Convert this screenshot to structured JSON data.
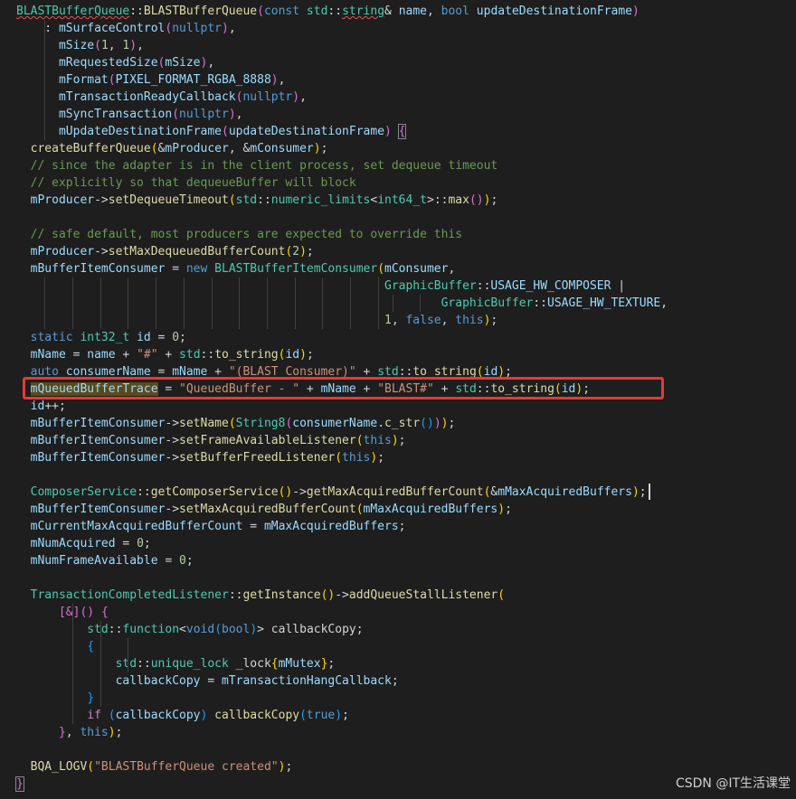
{
  "colors": {
    "background": "#1e1e1e",
    "plain": "#d4d4d4",
    "keyword": "#569cd6",
    "control": "#c586c0",
    "type": "#4ec9b0",
    "function": "#dcdcaa",
    "variable": "#9cdcfe",
    "string": "#ce9178",
    "number": "#b5cea8",
    "comment": "#6a9955",
    "bracket1": "#ffd700",
    "bracket2": "#da70d6",
    "bracket3": "#179fff",
    "highlight_box": "#e53935"
  },
  "watermark": "CSDN @IT生活课堂",
  "code_lines": [
    [
      [
        "BLASTBufferQueue",
        "t",
        "sq"
      ],
      [
        "::",
        "p"
      ],
      [
        "BLASTBufferQueue",
        "f"
      ],
      [
        "(",
        "b2"
      ],
      [
        "const",
        "k"
      ],
      [
        " ",
        "p"
      ],
      [
        "std",
        "t"
      ],
      [
        "::",
        "p"
      ],
      [
        "string",
        "t",
        "sq"
      ],
      [
        "& ",
        "p"
      ],
      [
        "name",
        "v"
      ],
      [
        ", ",
        "p"
      ],
      [
        "bool",
        "k"
      ],
      [
        " ",
        "p"
      ],
      [
        "updateDestinationFrame",
        "v"
      ],
      [
        ")",
        "b2"
      ]
    ],
    [
      [
        "    : ",
        "p"
      ],
      [
        "mSurfaceControl",
        "v"
      ],
      [
        "(",
        "b2"
      ],
      [
        "nullptr",
        "k"
      ],
      [
        ")",
        "b2"
      ],
      [
        ",",
        "p"
      ]
    ],
    [
      [
        "      ",
        "p"
      ],
      [
        "mSize",
        "v"
      ],
      [
        "(",
        "b2"
      ],
      [
        "1",
        "n"
      ],
      [
        ", ",
        "p"
      ],
      [
        "1",
        "n"
      ],
      [
        ")",
        "b2"
      ],
      [
        ",",
        "p"
      ]
    ],
    [
      [
        "      ",
        "p"
      ],
      [
        "mRequestedSize",
        "v"
      ],
      [
        "(",
        "b2"
      ],
      [
        "mSize",
        "v"
      ],
      [
        ")",
        "b2"
      ],
      [
        ",",
        "p"
      ]
    ],
    [
      [
        "      ",
        "p"
      ],
      [
        "mFormat",
        "v"
      ],
      [
        "(",
        "b2"
      ],
      [
        "PIXEL_FORMAT_RGBA_8888",
        "v"
      ],
      [
        ")",
        "b2"
      ],
      [
        ",",
        "p"
      ]
    ],
    [
      [
        "      ",
        "p"
      ],
      [
        "mTransactionReadyCallback",
        "v"
      ],
      [
        "(",
        "b2"
      ],
      [
        "nullptr",
        "k"
      ],
      [
        ")",
        "b2"
      ],
      [
        ",",
        "p"
      ]
    ],
    [
      [
        "      ",
        "p"
      ],
      [
        "mSyncTransaction",
        "v"
      ],
      [
        "(",
        "b2"
      ],
      [
        "nullptr",
        "k"
      ],
      [
        ")",
        "b2"
      ],
      [
        ",",
        "p"
      ]
    ],
    [
      [
        "      ",
        "p"
      ],
      [
        "mUpdateDestinationFrame",
        "v"
      ],
      [
        "(",
        "b2"
      ],
      [
        "updateDestinationFrame",
        "v"
      ],
      [
        ")",
        "b2"
      ],
      [
        " ",
        "p"
      ],
      [
        "{",
        "b2",
        "bm"
      ]
    ],
    [
      [
        "  ",
        "p"
      ],
      [
        "createBufferQueue",
        "f"
      ],
      [
        "(",
        "b1"
      ],
      [
        "&",
        "p"
      ],
      [
        "mProducer",
        "v"
      ],
      [
        ", &",
        "p"
      ],
      [
        "mConsumer",
        "v"
      ],
      [
        ")",
        "b1"
      ],
      [
        ";",
        "p"
      ]
    ],
    [
      [
        "  ",
        "p"
      ],
      [
        "// since the adapter is in the client process, set dequeue timeout",
        "c"
      ]
    ],
    [
      [
        "  ",
        "p"
      ],
      [
        "// explicitly so that dequeueBuffer will block",
        "c"
      ]
    ],
    [
      [
        "  ",
        "p"
      ],
      [
        "mProducer",
        "v"
      ],
      [
        "->",
        "p"
      ],
      [
        "setDequeueTimeout",
        "f"
      ],
      [
        "(",
        "b1"
      ],
      [
        "std",
        "t"
      ],
      [
        "::",
        "p"
      ],
      [
        "numeric_limits",
        "t"
      ],
      [
        "<",
        "p"
      ],
      [
        "int64_t",
        "t"
      ],
      [
        ">::",
        "p"
      ],
      [
        "max",
        "f"
      ],
      [
        "()",
        "b2"
      ],
      [
        ")",
        "b1"
      ],
      [
        ";",
        "p"
      ]
    ],
    [],
    [
      [
        "  ",
        "p"
      ],
      [
        "// safe default, most producers are expected to override this",
        "c"
      ]
    ],
    [
      [
        "  ",
        "p"
      ],
      [
        "mProducer",
        "v"
      ],
      [
        "->",
        "p"
      ],
      [
        "setMaxDequeuedBufferCount",
        "f"
      ],
      [
        "(",
        "b1"
      ],
      [
        "2",
        "n"
      ],
      [
        ")",
        "b1"
      ],
      [
        ";",
        "p"
      ]
    ],
    [
      [
        "  ",
        "p"
      ],
      [
        "mBufferItemConsumer",
        "v"
      ],
      [
        " = ",
        "p"
      ],
      [
        "new",
        "k"
      ],
      [
        " ",
        "p"
      ],
      [
        "BLASTBufferItemConsumer",
        "t"
      ],
      [
        "(",
        "b1"
      ],
      [
        "mConsumer",
        "v"
      ],
      [
        ",",
        "p"
      ]
    ],
    [
      [
        "                                                    ",
        "p"
      ],
      [
        "GraphicBuffer",
        "t"
      ],
      [
        "::",
        "p"
      ],
      [
        "USAGE_HW_COMPOSER",
        "v"
      ],
      [
        " |",
        "p"
      ]
    ],
    [
      [
        "                                                            ",
        "p"
      ],
      [
        "GraphicBuffer",
        "t"
      ],
      [
        "::",
        "p"
      ],
      [
        "USAGE_HW_TEXTURE",
        "v"
      ],
      [
        ",",
        "p"
      ]
    ],
    [
      [
        "                                                    ",
        "p"
      ],
      [
        "1",
        "n"
      ],
      [
        ", ",
        "p"
      ],
      [
        "false",
        "k"
      ],
      [
        ", ",
        "p"
      ],
      [
        "this",
        "k"
      ],
      [
        ")",
        "b1"
      ],
      [
        ";",
        "p"
      ]
    ],
    [
      [
        "  ",
        "p"
      ],
      [
        "static",
        "k"
      ],
      [
        " ",
        "p"
      ],
      [
        "int32_t",
        "t"
      ],
      [
        " ",
        "p"
      ],
      [
        "id",
        "v"
      ],
      [
        " = ",
        "p"
      ],
      [
        "0",
        "n"
      ],
      [
        ";",
        "p"
      ]
    ],
    [
      [
        "  ",
        "p"
      ],
      [
        "mName",
        "v"
      ],
      [
        " = ",
        "p"
      ],
      [
        "name",
        "v"
      ],
      [
        " + ",
        "p"
      ],
      [
        "\"#\"",
        "s"
      ],
      [
        " + ",
        "p"
      ],
      [
        "std",
        "t"
      ],
      [
        "::",
        "p"
      ],
      [
        "to_string",
        "f"
      ],
      [
        "(",
        "b1"
      ],
      [
        "id",
        "v"
      ],
      [
        ")",
        "b1"
      ],
      [
        ";",
        "p"
      ]
    ],
    [
      [
        "  ",
        "p"
      ],
      [
        "auto",
        "k"
      ],
      [
        " ",
        "p"
      ],
      [
        "consumerName",
        "v"
      ],
      [
        " = ",
        "p"
      ],
      [
        "mName",
        "v"
      ],
      [
        " + ",
        "p"
      ],
      [
        "\"(BLAST Consumer)\"",
        "s"
      ],
      [
        " + ",
        "p"
      ],
      [
        "std",
        "t"
      ],
      [
        "::",
        "p"
      ],
      [
        "to_string",
        "f"
      ],
      [
        "(",
        "b1"
      ],
      [
        "id",
        "v"
      ],
      [
        ")",
        "b1"
      ],
      [
        ";",
        "p"
      ]
    ],
    [
      [
        "  ",
        "p"
      ],
      [
        "mQueuedBufferTrace",
        "v",
        "hl"
      ],
      [
        " = ",
        "p"
      ],
      [
        "\"QueuedBuffer - \"",
        "s"
      ],
      [
        " + ",
        "p"
      ],
      [
        "mName",
        "v"
      ],
      [
        " + ",
        "p"
      ],
      [
        "\"BLAST#\"",
        "s"
      ],
      [
        " + ",
        "p"
      ],
      [
        "std",
        "t"
      ],
      [
        "::",
        "p"
      ],
      [
        "to_string",
        "f"
      ],
      [
        "(",
        "b1"
      ],
      [
        "id",
        "v"
      ],
      [
        ")",
        "b1"
      ],
      [
        ";",
        "p"
      ]
    ],
    [
      [
        "  ",
        "p"
      ],
      [
        "id",
        "v"
      ],
      [
        "++;",
        "p"
      ]
    ],
    [
      [
        "  ",
        "p"
      ],
      [
        "mBufferItemConsumer",
        "v"
      ],
      [
        "->",
        "p"
      ],
      [
        "setName",
        "f"
      ],
      [
        "(",
        "b1"
      ],
      [
        "String8",
        "t"
      ],
      [
        "(",
        "b2"
      ],
      [
        "consumerName",
        "v"
      ],
      [
        ".",
        "p"
      ],
      [
        "c_str",
        "f"
      ],
      [
        "()",
        "b3"
      ],
      [
        ")",
        "b2"
      ],
      [
        ")",
        "b1"
      ],
      [
        ";",
        "p"
      ]
    ],
    [
      [
        "  ",
        "p"
      ],
      [
        "mBufferItemConsumer",
        "v"
      ],
      [
        "->",
        "p"
      ],
      [
        "setFrameAvailableListener",
        "f"
      ],
      [
        "(",
        "b1"
      ],
      [
        "this",
        "k"
      ],
      [
        ")",
        "b1"
      ],
      [
        ";",
        "p"
      ]
    ],
    [
      [
        "  ",
        "p"
      ],
      [
        "mBufferItemConsumer",
        "v"
      ],
      [
        "->",
        "p"
      ],
      [
        "setBufferFreedListener",
        "f"
      ],
      [
        "(",
        "b1"
      ],
      [
        "this",
        "k"
      ],
      [
        ")",
        "b1"
      ],
      [
        ";",
        "p"
      ]
    ],
    [],
    [
      [
        "  ",
        "p"
      ],
      [
        "ComposerService",
        "t"
      ],
      [
        "::",
        "p"
      ],
      [
        "getComposerService",
        "f"
      ],
      [
        "()",
        "b1"
      ],
      [
        "->",
        "p"
      ],
      [
        "getMaxAcquiredBufferCount",
        "f"
      ],
      [
        "(",
        "b1"
      ],
      [
        "&",
        "p"
      ],
      [
        "mMaxAcquiredBuffers",
        "v"
      ],
      [
        ")",
        "b1"
      ],
      [
        ";",
        "p"
      ]
    ],
    [
      [
        "  ",
        "p"
      ],
      [
        "mBufferItemConsumer",
        "v"
      ],
      [
        "->",
        "p"
      ],
      [
        "setMaxAcquiredBufferCount",
        "f"
      ],
      [
        "(",
        "b1"
      ],
      [
        "mMaxAcquiredBuffers",
        "v"
      ],
      [
        ")",
        "b1"
      ],
      [
        ";",
        "p"
      ]
    ],
    [
      [
        "  ",
        "p"
      ],
      [
        "mCurrentMaxAcquiredBufferCount",
        "v"
      ],
      [
        " = ",
        "p"
      ],
      [
        "mMaxAcquiredBuffers",
        "v"
      ],
      [
        ";",
        "p"
      ]
    ],
    [
      [
        "  ",
        "p"
      ],
      [
        "mNumAcquired",
        "v"
      ],
      [
        " = ",
        "p"
      ],
      [
        "0",
        "n"
      ],
      [
        ";",
        "p"
      ]
    ],
    [
      [
        "  ",
        "p"
      ],
      [
        "mNumFrameAvailable",
        "v"
      ],
      [
        " = ",
        "p"
      ],
      [
        "0",
        "n"
      ],
      [
        ";",
        "p"
      ]
    ],
    [],
    [
      [
        "  ",
        "p"
      ],
      [
        "TransactionCompletedListener",
        "t"
      ],
      [
        "::",
        "p"
      ],
      [
        "getInstance",
        "f"
      ],
      [
        "()",
        "b1"
      ],
      [
        "->",
        "p"
      ],
      [
        "addQueueStallListener",
        "f"
      ],
      [
        "(",
        "b1"
      ]
    ],
    [
      [
        "      ",
        "p"
      ],
      [
        "[&]",
        "b2"
      ],
      [
        "()",
        "b2"
      ],
      [
        " ",
        "p"
      ],
      [
        "{",
        "b2"
      ]
    ],
    [
      [
        "          ",
        "p"
      ],
      [
        "std",
        "t"
      ],
      [
        "::",
        "p"
      ],
      [
        "function",
        "t"
      ],
      [
        "<",
        "p"
      ],
      [
        "void",
        "k"
      ],
      [
        "(",
        "b3"
      ],
      [
        "bool",
        "k"
      ],
      [
        ")",
        "b3"
      ],
      [
        ">",
        "p"
      ],
      [
        " callbackCopy;",
        "p"
      ]
    ],
    [
      [
        "          ",
        "p"
      ],
      [
        "{",
        "b3"
      ]
    ],
    [
      [
        "              ",
        "p"
      ],
      [
        "std",
        "t"
      ],
      [
        "::",
        "p"
      ],
      [
        "unique_lock",
        "t"
      ],
      [
        " _lock",
        "p"
      ],
      [
        "{",
        "b1"
      ],
      [
        "mMutex",
        "v"
      ],
      [
        "}",
        "b1"
      ],
      [
        ";",
        "p"
      ]
    ],
    [
      [
        "              ",
        "p"
      ],
      [
        "callbackCopy",
        "v"
      ],
      [
        " = ",
        "p"
      ],
      [
        "mTransactionHangCallback",
        "v"
      ],
      [
        ";",
        "p"
      ]
    ],
    [
      [
        "          ",
        "p"
      ],
      [
        "}",
        "b3"
      ]
    ],
    [
      [
        "          ",
        "p"
      ],
      [
        "if",
        "x"
      ],
      [
        " ",
        "p"
      ],
      [
        "(",
        "b3"
      ],
      [
        "callbackCopy",
        "v"
      ],
      [
        ")",
        "b3"
      ],
      [
        " ",
        "p"
      ],
      [
        "callbackCopy",
        "f"
      ],
      [
        "(",
        "b3"
      ],
      [
        "true",
        "k"
      ],
      [
        ")",
        "b3"
      ],
      [
        ";",
        "p"
      ]
    ],
    [
      [
        "      ",
        "p"
      ],
      [
        "}",
        "b2"
      ],
      [
        ", ",
        "p"
      ],
      [
        "this",
        "k"
      ],
      [
        ")",
        "b1"
      ],
      [
        ";",
        "p"
      ]
    ],
    [],
    [
      [
        "  ",
        "p"
      ],
      [
        "BQA_LOGV",
        "f"
      ],
      [
        "(",
        "b1"
      ],
      [
        "\"BLASTBufferQueue created\"",
        "s"
      ],
      [
        ")",
        "b1"
      ],
      [
        ";",
        "p"
      ]
    ],
    [
      [
        "}",
        "b2",
        "bm"
      ]
    ]
  ]
}
